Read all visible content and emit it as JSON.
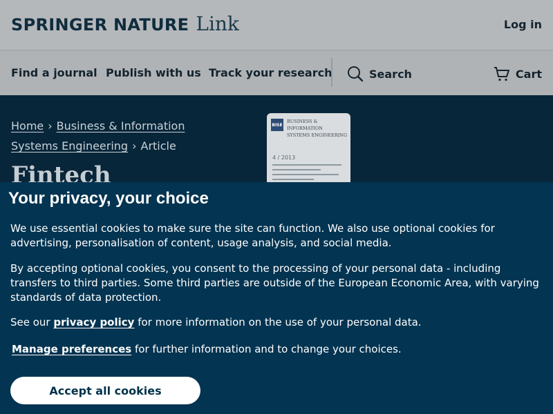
{
  "header": {
    "brand_main": "SPRINGER NATURE",
    "brand_link": "Link",
    "login": "Log in"
  },
  "nav": {
    "items": [
      "Find a journal",
      "Publish with us",
      "Track your research"
    ],
    "search": "Search",
    "cart": "Cart",
    "icons": [
      "search-icon",
      "cart-icon"
    ]
  },
  "hero": {
    "breadcrumb": {
      "home": "Home",
      "journal": "Business & Information Systems Engineering",
      "current": "Article"
    },
    "title_partial": "Fintech",
    "cover": {
      "logo": "BISE",
      "journal_name": [
        "BUSINESS & INFORMATION",
        "SYSTEMS ENGINEERING"
      ],
      "issue": "4 / 2013"
    }
  },
  "privacy": {
    "title": "Your privacy, your choice",
    "p1": "We use essential cookies to make sure the site can function. We also use optional cookies for advertising, personalisation of content, usage analysis, and social media.",
    "p2": "By accepting optional cookies, you consent to the processing of your personal data - including transfers to third parties. Some third parties are outside of the European Economic Area, with varying standards of data protection.",
    "p3_before": "See our ",
    "p3_link": "privacy policy",
    "p3_after": " for more information on the use of your personal data.",
    "p4_link": "Manage preferences",
    "p4_after": " for further information and to change your choices.",
    "accept_button": "Accept all cookies"
  },
  "colors": {
    "banner_bg": "#033451",
    "hero_bg": "#08263a",
    "button_text": "#01324b"
  }
}
